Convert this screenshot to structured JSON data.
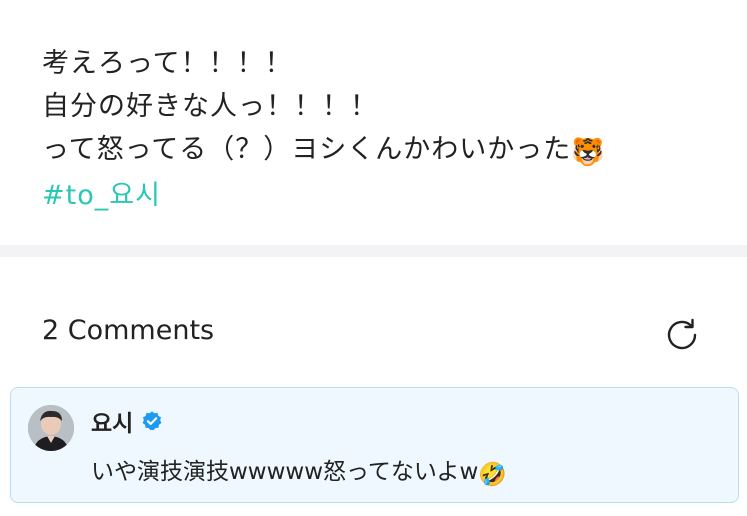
{
  "post": {
    "lines": [
      "考えろって！！！！",
      "自分の好きな人っ！！！！",
      "って怒ってる（？）ヨシくんかわいかった"
    ],
    "line3_emoji": "🐯",
    "hashtag": "#to_요시"
  },
  "comments": {
    "title": "2 Comments",
    "refresh_icon": "refresh-icon"
  },
  "comment": {
    "author": "요시",
    "verified_icon": "verified-badge-icon",
    "text": "いや演技演技wwwww怒ってないよw",
    "text_emoji": "🤣"
  },
  "colors": {
    "hashtag": "#2cc7b4",
    "comment_bg": "#eef8fe",
    "comment_border": "#b9def3",
    "verified": "#1d9bf0",
    "divider": "#f3f3f5"
  }
}
